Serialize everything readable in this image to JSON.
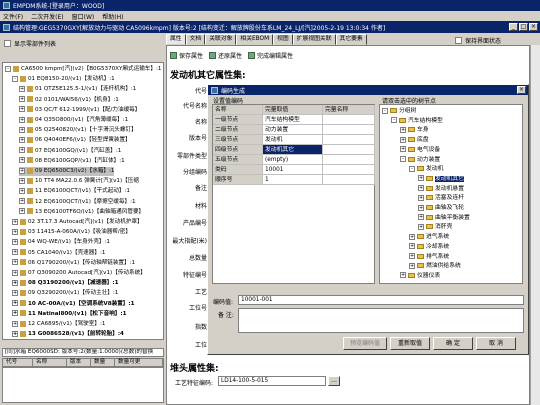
{
  "app": {
    "title": "EMPDM系统-[登录用户：WOOD]",
    "menu": [
      "文件(F)",
      "二次开发(E)",
      "窗口(W)",
      "帮助(H)"
    ],
    "window_title": "结构管理:GEG5370GXY[解放动力与驱动 CA5096kmpm] 版本号:2 [结构变迁：解放牌股份车系LM_24_LJ/[汽]2005-2-19 13:0:34 作者]"
  },
  "left": {
    "show_zero_label": "显示零部件列表",
    "tree": [
      {
        "text": "CA6500 kmpm[汽](v2)【B0G5370XY厢式运输车】:1",
        "level": 0,
        "exp": "-",
        "bold": false
      },
      {
        "text": "01 EQ8150-20/(v1)【发动机】:1",
        "level": 1,
        "exp": "-",
        "bold": false
      },
      {
        "text": "01 QTZ5E125.5-1/(v1)【连杆机构】:1",
        "level": 2,
        "exp": "+",
        "bold": false
      },
      {
        "text": "02 0101/WAI56/(v1)【机身】:1",
        "level": 2,
        "exp": "+",
        "bold": false
      },
      {
        "text": "03 QC/T 612-1999/(v1)【配/力油缓每】",
        "level": 2,
        "exp": "+",
        "bold": false
      },
      {
        "text": "04 Q35O800/(v1)【汽角薄缓每】:1",
        "level": 2,
        "exp": "+",
        "bold": false
      },
      {
        "text": "05 Q2540820/(v1)【十字滑沉头螺钉】",
        "level": 2,
        "exp": "+",
        "bold": false
      },
      {
        "text": "06 Q4040EF6/(v1)【轻型焊簧装置】",
        "level": 2,
        "exp": "+",
        "bold": false
      },
      {
        "text": "07 EQ6100GQ/(v1)【汽缸盖】:1",
        "level": 2,
        "exp": "+",
        "bold": false
      },
      {
        "text": "08 EQ6100GQP/(v1)【汽缸体】:1",
        "level": 2,
        "exp": "+",
        "bold": false
      },
      {
        "text": "09 EQ6500C3/(v2)【水箱】:1",
        "level": 2,
        "exp": "+",
        "bold": false,
        "selected": true
      },
      {
        "text": "10 TT4 MA22.0.6 弹簧计[汽](v1)【压缩",
        "level": 2,
        "exp": "+",
        "bold": false
      },
      {
        "text": "11 EQ6100QCT/(v1)【干式起动】:1",
        "level": 2,
        "exp": "+",
        "bold": false
      },
      {
        "text": "12 EQ6100QCT/(v1)【摩擦空缓每】:1",
        "level": 2,
        "exp": "+",
        "bold": false
      },
      {
        "text": "13 EQ6100TF6O/(v1)【曲轴箱通风管要】",
        "level": 2,
        "exp": "+",
        "bold": false
      },
      {
        "text": "02 3T.17.3 Autocad[汽](v1)【发动机护罩】",
        "level": 1,
        "exp": "+",
        "bold": false
      },
      {
        "text": "03 11415-A-060A/(v1)【吸油器帮/密】",
        "level": 1,
        "exp": "+",
        "bold": false
      },
      {
        "text": "04 WQ-WE/(v1)【车身外壳】:1",
        "level": 1,
        "exp": "+",
        "bold": false
      },
      {
        "text": "05 CA1040/(v1)【壳速器】:1",
        "level": 1,
        "exp": "+",
        "bold": false
      },
      {
        "text": "06 Q1790200/(v1)【传动轴帮链装置】:1",
        "level": 1,
        "exp": "+",
        "bold": false
      },
      {
        "text": "07 Q3090200 Autocad[汽](v1)【传动系统】",
        "level": 1,
        "exp": "+",
        "bold": false
      },
      {
        "text": "08 Q3190200/(v1)【减速器】:1",
        "level": 1,
        "exp": "+",
        "bold": true
      },
      {
        "text": "09 Q3290200/(v1)【传动主壮】:1",
        "level": 1,
        "exp": "+",
        "bold": false
      },
      {
        "text": "10 AC-00A/(v1)【空调系统V8装置】:1",
        "level": 1,
        "exp": "+",
        "bold": true
      },
      {
        "text": "11 Natinal800/(v1)【松下音响】:1",
        "level": 1,
        "exp": "+",
        "bold": true
      },
      {
        "text": "12 CA6895/(v1)【驾驶室】:1",
        "level": 1,
        "exp": "+",
        "bold": false
      },
      {
        "text": "13 G0086528/(v1)【前转轮胎】:4",
        "level": 1,
        "exp": "+",
        "bold": true
      }
    ],
    "selected_label": "[同]水箱 EQ6000SD: 版本号:2(数量:1.0000)(总数)的替换",
    "grid_headers": [
      "代号",
      "名称",
      "版本",
      "数量",
      "数量可更"
    ]
  },
  "right": {
    "tabs": [
      "属性",
      "文档",
      "关联对象",
      "相关EBOM",
      "视图",
      "扩展视图关联",
      "其它要素"
    ],
    "active_tab": 0,
    "keep_open_label": "保持界面状态",
    "toolbar": [
      "保存属性",
      "还原属性",
      "完成编辑属性"
    ],
    "section_title": "发动机其它属性集:",
    "props": [
      "代号",
      "代号名称",
      "名称",
      "版本号",
      "零部件类型",
      "分组编码",
      "备注",
      "材料",
      "产品编号",
      "最大指配(米)",
      "总数量",
      "特征编号",
      "工艺",
      "工位号",
      "指数",
      "工位"
    ],
    "prop2_title": "堆头属性集:",
    "prop2_label": "工艺特征编码:",
    "prop2_value": "LD14-100-5-015"
  },
  "dialog": {
    "title": "编码生成",
    "left_caption": "设置值编码",
    "tree_caption": "请双击选中的树节点",
    "table_headers": [
      "名称",
      "完量取值",
      "完量名称"
    ],
    "rows": [
      {
        "name": "一级节点",
        "value": "汽车结构模型",
        "tag": ""
      },
      {
        "name": "二级节点",
        "value": "动力装置",
        "tag": ""
      },
      {
        "name": "三级节点",
        "value": "发动机",
        "tag": ""
      },
      {
        "name": "四级节点",
        "value": "发动机其它",
        "tag": "",
        "selected": true
      },
      {
        "name": "五级节点",
        "value": "(empty)",
        "tag": ""
      },
      {
        "name": "类码",
        "value": "10001",
        "tag": ""
      },
      {
        "name": "顺序号",
        "value": "1",
        "tag": ""
      }
    ],
    "tree": [
      {
        "text": "分组树",
        "level": 0,
        "exp": "-"
      },
      {
        "text": "汽车结构模型",
        "level": 1,
        "exp": "-"
      },
      {
        "text": "车身",
        "level": 2,
        "exp": "+"
      },
      {
        "text": "底盘",
        "level": 2,
        "exp": "+"
      },
      {
        "text": "电气设备",
        "level": 2,
        "exp": "+"
      },
      {
        "text": "动力装置",
        "level": 2,
        "exp": "-"
      },
      {
        "text": "发动机",
        "level": 3,
        "exp": "-"
      },
      {
        "text": "发动机其它",
        "level": 4,
        "exp": "+",
        "selected": true
      },
      {
        "text": "发动机悬置",
        "level": 4,
        "exp": "+"
      },
      {
        "text": "活塞及连杆",
        "level": 4,
        "exp": "+"
      },
      {
        "text": "曲轴及飞轮",
        "level": 4,
        "exp": "+"
      },
      {
        "text": "曲轴平衡装置",
        "level": 4,
        "exp": "+"
      },
      {
        "text": "消肝壳",
        "level": 4,
        "exp": "+"
      },
      {
        "text": "进气系统",
        "level": 3,
        "exp": "+"
      },
      {
        "text": "冷却系统",
        "level": 3,
        "exp": "+"
      },
      {
        "text": "排气系统",
        "level": 3,
        "exp": "+"
      },
      {
        "text": "燃油供给系统",
        "level": 3,
        "exp": "+"
      },
      {
        "text": "仪器仪表",
        "level": 2,
        "exp": "+"
      }
    ],
    "code_label": "编码值:",
    "code_value": "10001-001",
    "remark_label": "备 注:",
    "buttons": [
      "预览编码值",
      "重新取值",
      "确 定",
      "取 消"
    ]
  }
}
